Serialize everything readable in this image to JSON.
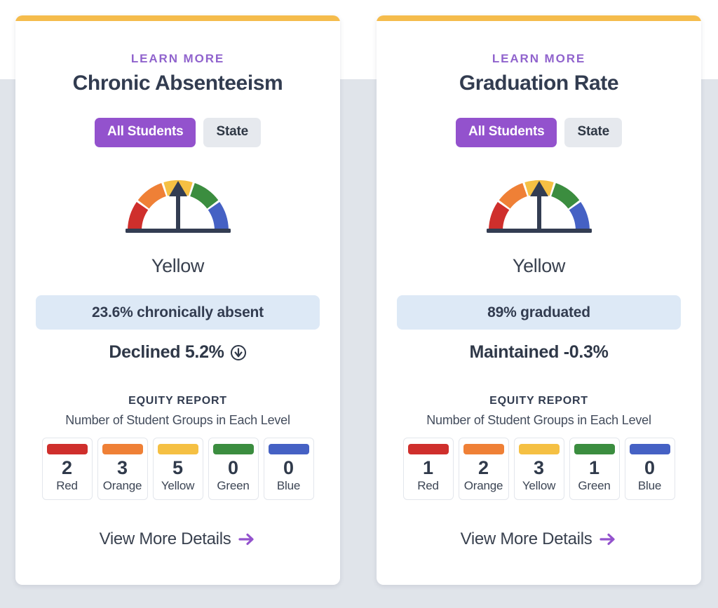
{
  "theme": {
    "accent_bar_color": "#f5bc4c",
    "purple": "#9063cd",
    "pill_active_bg": "#9352cd",
    "pill_inactive_bg": "#e6e9ee",
    "stat_bar_bg": "#dde9f6",
    "text_dark": "#323c50",
    "page_bg": "#e0e4ea",
    "needle_color": "#333d52"
  },
  "levels": [
    {
      "name": "Red",
      "color": "#cf2f2c"
    },
    {
      "name": "Orange",
      "color": "#ef8036"
    },
    {
      "name": "Yellow",
      "color": "#f5c043"
    },
    {
      "name": "Green",
      "color": "#3b8d3f"
    },
    {
      "name": "Blue",
      "color": "#4561c4"
    }
  ],
  "cards": [
    {
      "learn_more_label": "Learn More",
      "title": "Chronic Absenteeism",
      "toggles": [
        {
          "label": "All Students",
          "active": true
        },
        {
          "label": "State",
          "active": false
        }
      ],
      "gauge": {
        "level_label": "Yellow",
        "pointer_level_index": 2,
        "segment_colors": [
          "#cf2f2c",
          "#ef8036",
          "#f5c043",
          "#3b8d3f",
          "#4561c4"
        ]
      },
      "stat_text": "23.6% chronically absent",
      "trend_text": "Declined 5.2%",
      "trend_icon": "circle-arrow-down-icon",
      "equity": {
        "heading": "Equity Report",
        "subheading": "Number of Student Groups in Each Level",
        "cells": [
          {
            "count": "2",
            "label": "Red",
            "color": "#cf2f2c"
          },
          {
            "count": "3",
            "label": "Orange",
            "color": "#ef8036"
          },
          {
            "count": "5",
            "label": "Yellow",
            "color": "#f5c043"
          },
          {
            "count": "0",
            "label": "Green",
            "color": "#3b8d3f"
          },
          {
            "count": "0",
            "label": "Blue",
            "color": "#4561c4"
          }
        ]
      },
      "details_label": "View More Details",
      "details_icon": "arrow-right-icon"
    },
    {
      "learn_more_label": "Learn More",
      "title": "Graduation Rate",
      "toggles": [
        {
          "label": "All Students",
          "active": true
        },
        {
          "label": "State",
          "active": false
        }
      ],
      "gauge": {
        "level_label": "Yellow",
        "pointer_level_index": 2,
        "segment_colors": [
          "#cf2f2c",
          "#ef8036",
          "#f5c043",
          "#3b8d3f",
          "#4561c4"
        ]
      },
      "stat_text": "89% graduated",
      "trend_text": "Maintained -0.3%",
      "trend_icon": null,
      "equity": {
        "heading": "Equity Report",
        "subheading": "Number of Student Groups in Each Level",
        "cells": [
          {
            "count": "1",
            "label": "Red",
            "color": "#cf2f2c"
          },
          {
            "count": "2",
            "label": "Orange",
            "color": "#ef8036"
          },
          {
            "count": "3",
            "label": "Yellow",
            "color": "#f5c043"
          },
          {
            "count": "1",
            "label": "Green",
            "color": "#3b8d3f"
          },
          {
            "count": "0",
            "label": "Blue",
            "color": "#4561c4"
          }
        ]
      },
      "details_label": "View More Details",
      "details_icon": "arrow-right-icon"
    }
  ]
}
